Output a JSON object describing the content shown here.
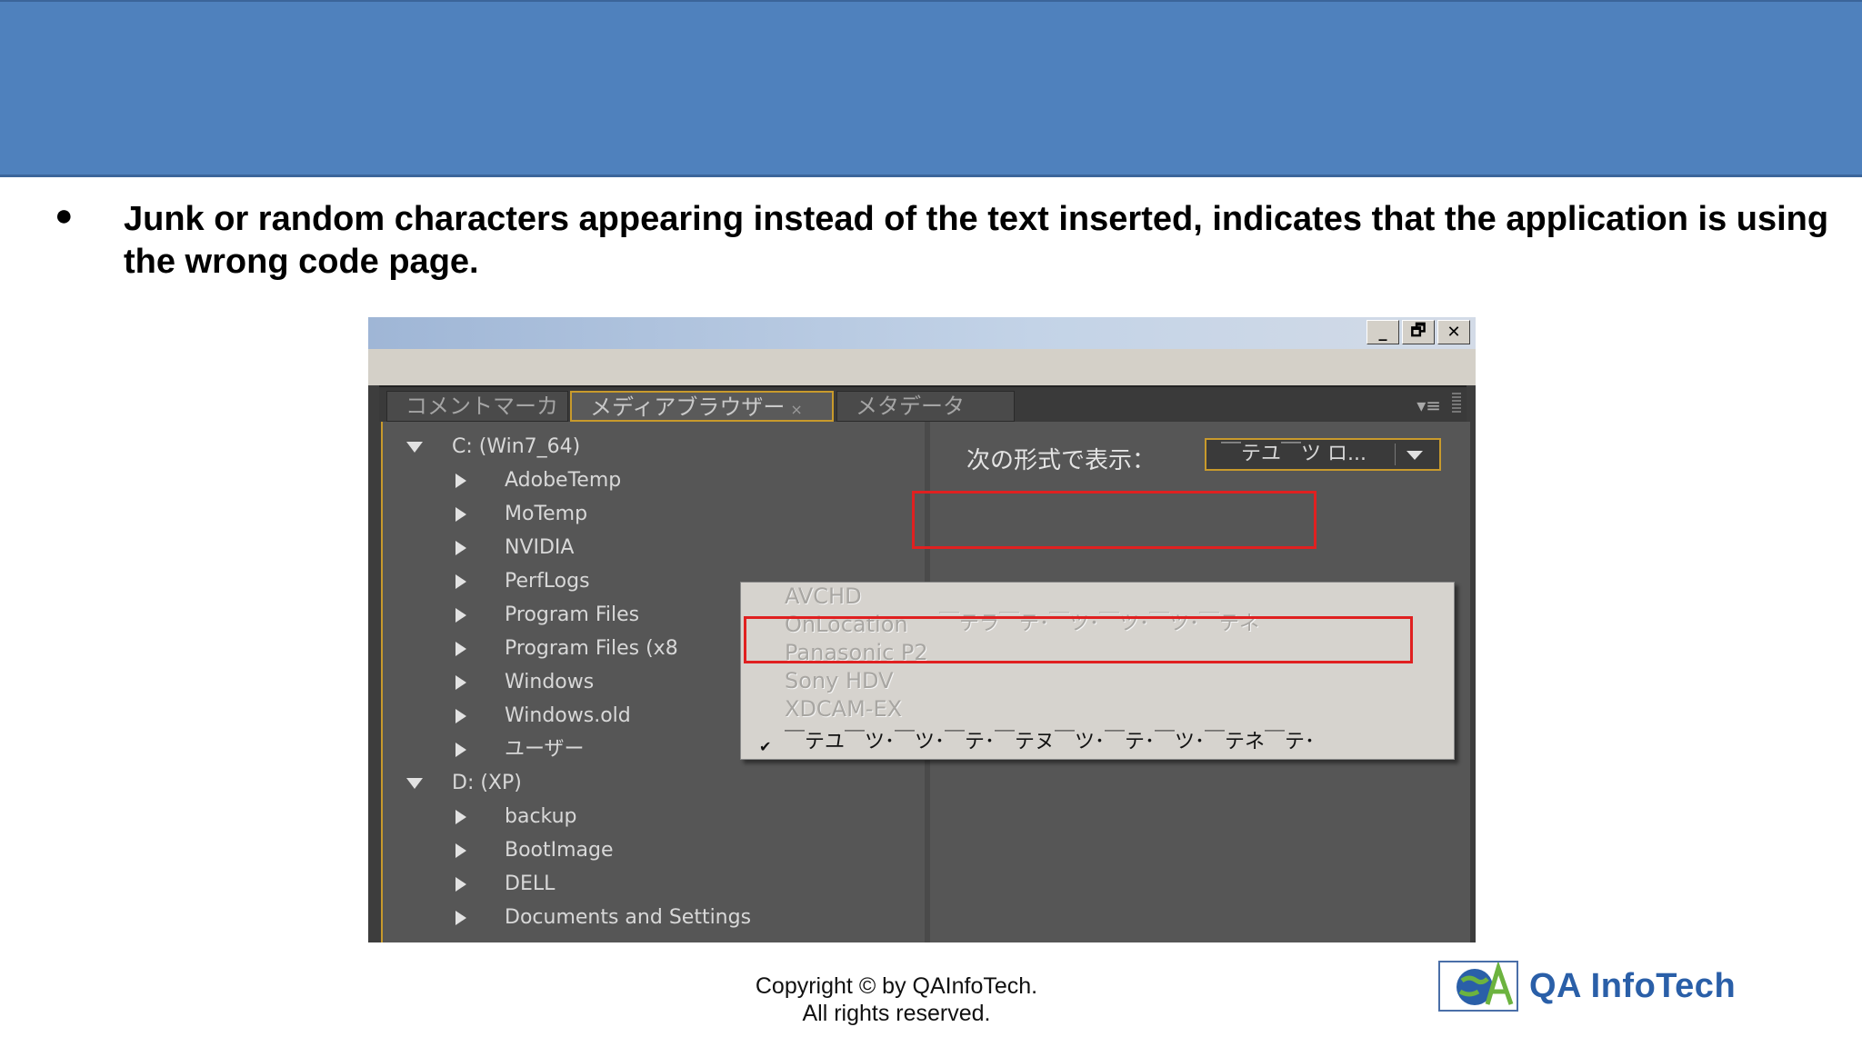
{
  "slide": {
    "bullet_char": "●",
    "bullet_text": "Junk or random characters appearing instead of the text inserted, indicates that the application is using the wrong code page.",
    "copyright_line1": "Copyright © by QAInfoTech.",
    "copyright_line2": "All rights reserved.",
    "logo_text": "QA InfoTech"
  },
  "window": {
    "minimize_glyph": "_",
    "restore_glyph": "🗗",
    "close_glyph": "✕"
  },
  "panel": {
    "tabs": [
      {
        "label": "コメントマーカー"
      },
      {
        "label": "メディアブラウザー",
        "close": "×"
      },
      {
        "label": "メタデータ"
      }
    ],
    "menu_glyph": "▾≡"
  },
  "tree": {
    "items": [
      {
        "label": "C: (Win7_64)",
        "level": 0,
        "expanded": true
      },
      {
        "label": "AdobeTemp",
        "level": 1
      },
      {
        "label": "MoTemp",
        "level": 1
      },
      {
        "label": "NVIDIA",
        "level": 1
      },
      {
        "label": "PerfLogs",
        "level": 1
      },
      {
        "label": "Program Files",
        "level": 1
      },
      {
        "label": "Program Files (x8",
        "level": 1
      },
      {
        "label": "Windows",
        "level": 1
      },
      {
        "label": "Windows.old",
        "level": 1
      },
      {
        "label": "ユーザー",
        "level": 1
      },
      {
        "label": "D: (XP)",
        "level": 0,
        "expanded": true
      },
      {
        "label": "backup",
        "level": 1
      },
      {
        "label": "BootImage",
        "level": 1
      },
      {
        "label": "DELL",
        "level": 1
      },
      {
        "label": "Documents and Settings",
        "level": 1
      }
    ]
  },
  "view_as": {
    "label": "次の形式で表示：",
    "selected": "￣テユ￣ツ ロ..."
  },
  "dropdown": {
    "items": [
      {
        "label": "AVCHD",
        "disabled": true
      },
      {
        "label": "OnLocation",
        "disabled": true
      },
      {
        "label": "Panasonic P2",
        "disabled": true
      },
      {
        "label": "Sony HDV",
        "disabled": true
      },
      {
        "label": "XDCAM-EX",
        "disabled": true
      },
      {
        "label": "￣テユ￣ツ･￣ツ･￣テ･￣テヌ￣ツ･￣テ･￣ツ･￣テネ￣テ･",
        "disabled": false,
        "checked": true
      }
    ],
    "check_glyph": "✔",
    "junk_overlay": "￣テラ￣テ･￣ツ･￣ツ･￣ツ･￣テネ"
  },
  "colors": {
    "banner": "#4f81bd",
    "highlight_box": "#e02020",
    "panel_accent": "#c89a2c"
  }
}
